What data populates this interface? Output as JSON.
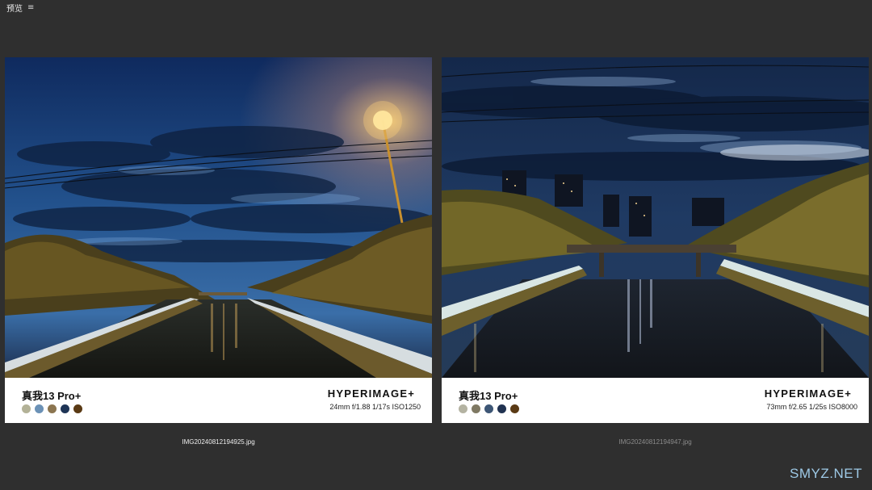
{
  "topbar": {
    "title": "预览",
    "menu_icon": "≡"
  },
  "images": [
    {
      "model": "真我13 Pro+",
      "brand": "HYPERIMAGE+",
      "exif": "24mm  f/1.88  1/17s  ISO1250",
      "filename": "IMG20240812194925.jpg",
      "palette": [
        "#b3b297",
        "#6b91b6",
        "#8b7550",
        "#1e3456",
        "#5a3a14"
      ]
    },
    {
      "model": "真我13 Pro+",
      "brand": "HYPERIMAGE+",
      "exif": "73mm  f/2.65  1/25s  ISO8000",
      "filename": "IMG20240812194947.jpg",
      "palette": [
        "#b4b3a2",
        "#7f7963",
        "#3d5675",
        "#213251",
        "#5a3a14"
      ]
    }
  ],
  "watermark": "SMYZ.NET"
}
